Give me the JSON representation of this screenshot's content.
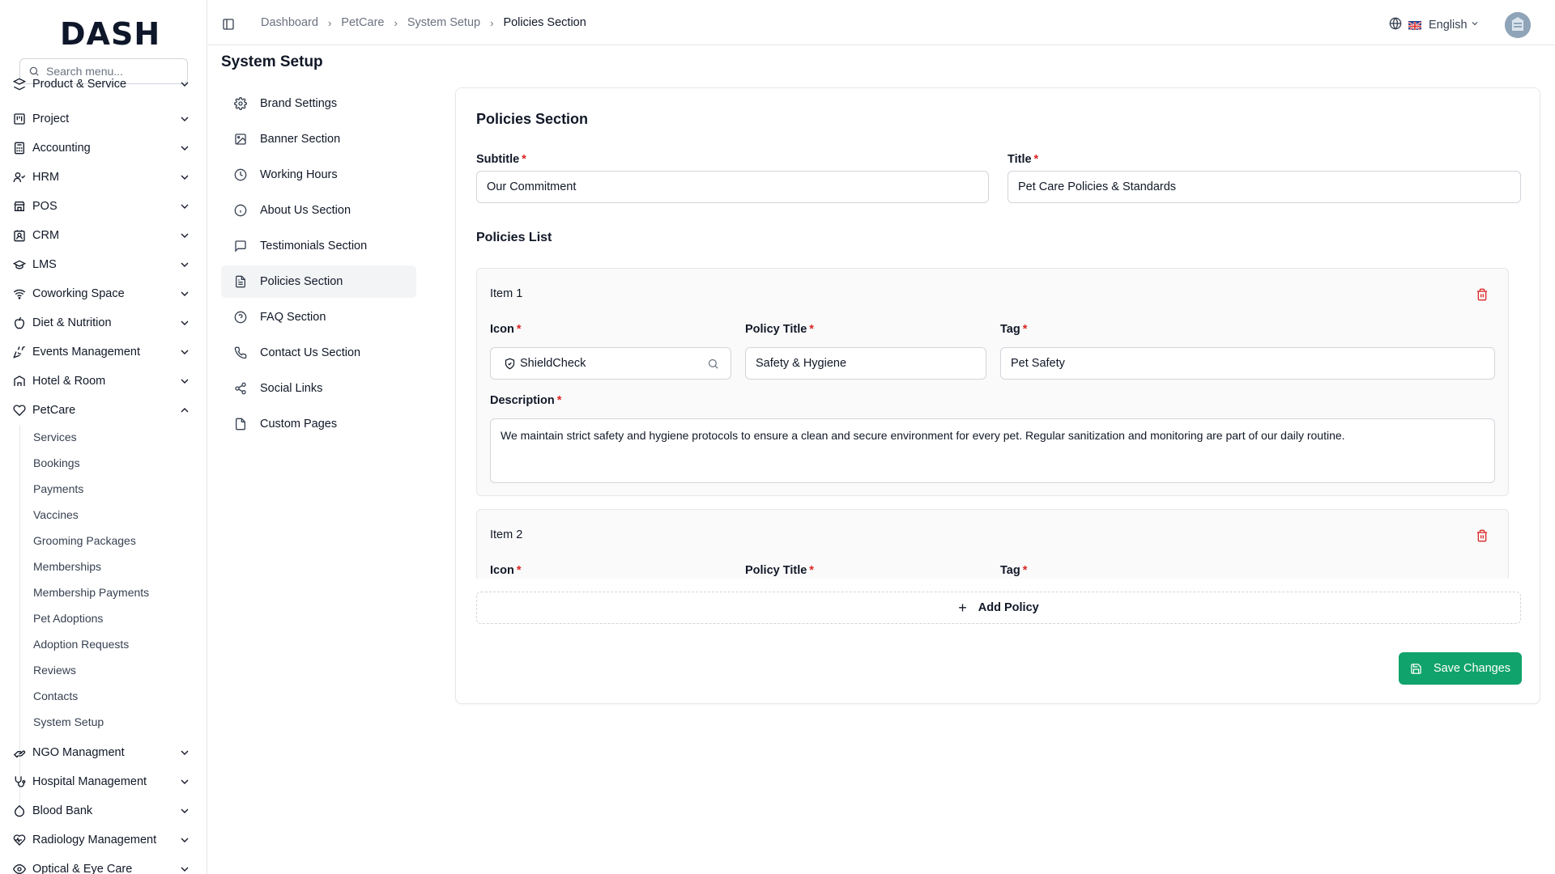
{
  "app": {
    "logo": "DASH"
  },
  "sidebar": {
    "search_placeholder": "Search menu...",
    "items": [
      {
        "label": "Product & Service",
        "icon": "layers-icon"
      },
      {
        "label": "Project",
        "icon": "kanban-icon"
      },
      {
        "label": "Accounting",
        "icon": "calculator-icon"
      },
      {
        "label": "HRM",
        "icon": "users-icon"
      },
      {
        "label": "POS",
        "icon": "store-icon"
      },
      {
        "label": "CRM",
        "icon": "contact-icon"
      },
      {
        "label": "LMS",
        "icon": "graduation-cap-icon"
      },
      {
        "label": "Coworking Space",
        "icon": "wifi-icon"
      },
      {
        "label": "Diet & Nutrition",
        "icon": "apple-icon"
      },
      {
        "label": "Events Management",
        "icon": "party-popper-icon"
      },
      {
        "label": "Hotel & Room",
        "icon": "hotel-icon"
      },
      {
        "label": "PetCare",
        "icon": "heart-paw-icon"
      }
    ],
    "petcare_sub": [
      "Services",
      "Bookings",
      "Payments",
      "Vaccines",
      "Grooming Packages",
      "Memberships",
      "Membership Payments",
      "Pet Adoptions",
      "Adoption Requests",
      "Reviews",
      "Contacts",
      "System Setup"
    ],
    "items_after": [
      {
        "label": "NGO Managment",
        "icon": "hand-heart-icon"
      },
      {
        "label": "Hospital Management",
        "icon": "stethoscope-icon"
      },
      {
        "label": "Blood Bank",
        "icon": "droplet-icon"
      },
      {
        "label": "Radiology Management",
        "icon": "activity-heart-icon"
      },
      {
        "label": "Optical & Eye Care",
        "icon": "eye-icon"
      }
    ]
  },
  "header": {
    "breadcrumb": [
      "Dashboard",
      "PetCare",
      "System Setup",
      "Policies Section"
    ],
    "language": "English"
  },
  "page": {
    "title": "System Setup"
  },
  "subnav": [
    {
      "label": "Brand Settings",
      "icon": "gear-icon"
    },
    {
      "label": "Banner Section",
      "icon": "image-icon"
    },
    {
      "label": "Working Hours",
      "icon": "clock-icon"
    },
    {
      "label": "About Us Section",
      "icon": "info-icon"
    },
    {
      "label": "Testimonials Section",
      "icon": "message-square-icon"
    },
    {
      "label": "Policies Section",
      "icon": "file-text-icon"
    },
    {
      "label": "FAQ Section",
      "icon": "help-circle-icon"
    },
    {
      "label": "Contact Us Section",
      "icon": "phone-icon"
    },
    {
      "label": "Social Links",
      "icon": "share-icon"
    },
    {
      "label": "Custom Pages",
      "icon": "file-icon"
    }
  ],
  "form": {
    "card_title": "Policies Section",
    "subtitle_label": "Subtitle",
    "subtitle_value": "Our Commitment",
    "title_label": "Title",
    "title_value": "Pet Care Policies & Standards",
    "list_title": "Policies List",
    "icon_label": "Icon",
    "policy_title_label": "Policy Title",
    "tag_label": "Tag",
    "description_label": "Description",
    "items": [
      {
        "label": "Item 1",
        "icon_value": "ShieldCheck",
        "policy_title": "Safety & Hygiene",
        "tag": "Pet Safety",
        "description": "We maintain strict safety and hygiene protocols to ensure a clean and secure environment for every pet. Regular sanitization and monitoring are part of our daily routine."
      },
      {
        "label": "Item 2"
      }
    ],
    "add_label": "Add Policy",
    "save_label": "Save Changes"
  },
  "colors": {
    "accent": "#10a36b",
    "danger": "#dc2626"
  }
}
